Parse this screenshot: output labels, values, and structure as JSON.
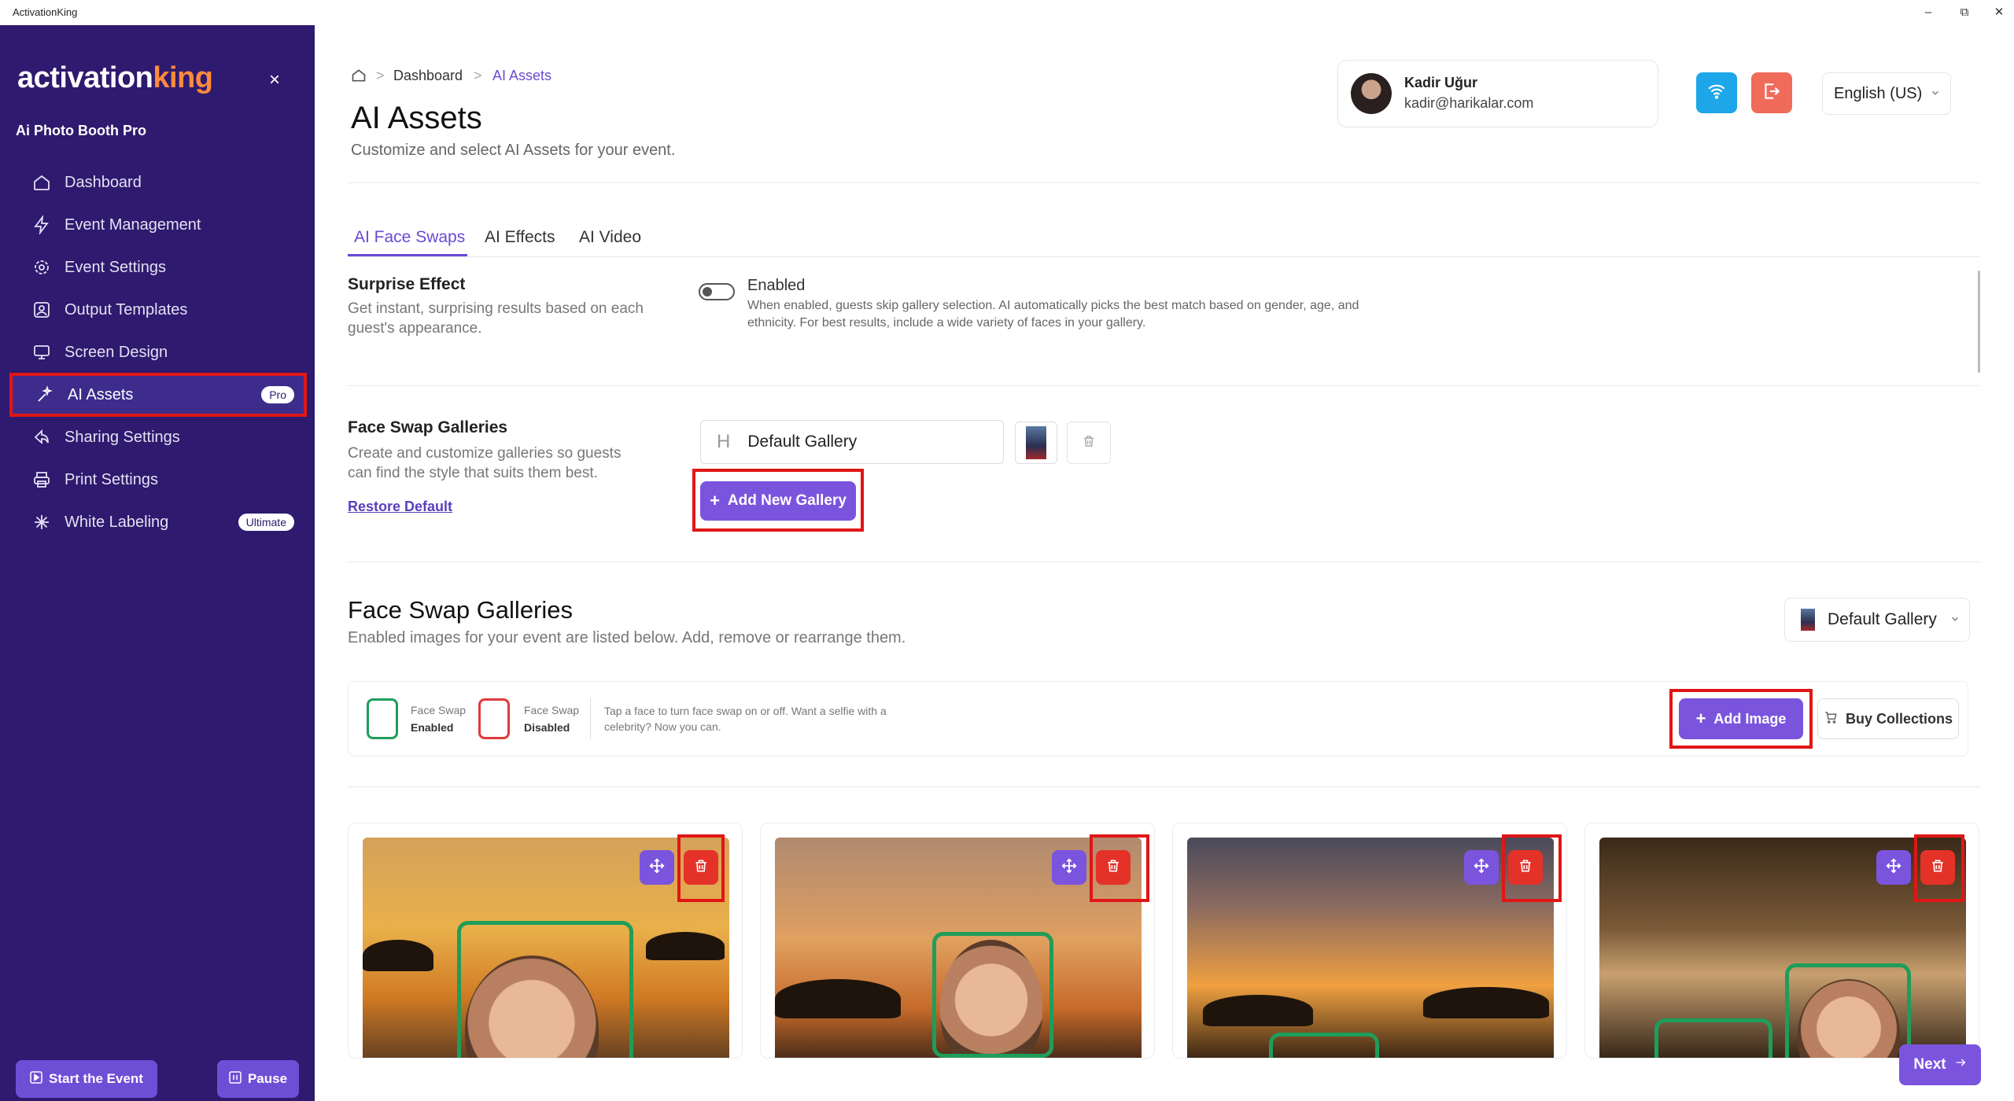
{
  "window": {
    "title": "ActivationKing",
    "minimize": "–",
    "restore": "⧉",
    "close": "✕"
  },
  "sidebar": {
    "logo_main": "activation",
    "logo_accent": "king",
    "close": "×",
    "section": "Ai Photo Booth Pro",
    "items": [
      {
        "label": "Dashboard",
        "icon": "home-icon"
      },
      {
        "label": "Event Management",
        "icon": "bolt-icon"
      },
      {
        "label": "Event Settings",
        "icon": "gear-icon"
      },
      {
        "label": "Output Templates",
        "icon": "portrait-icon"
      },
      {
        "label": "Screen Design",
        "icon": "monitor-icon"
      },
      {
        "label": "AI Assets",
        "icon": "sparkle-icon",
        "badge": "Pro",
        "active": true
      },
      {
        "label": "Sharing Settings",
        "icon": "share-icon"
      },
      {
        "label": "Print Settings",
        "icon": "printer-icon"
      },
      {
        "label": "White Labeling",
        "icon": "asterisk-icon",
        "badge": "Ultimate"
      }
    ],
    "start_button": "Start the Event",
    "pause_button": "Pause"
  },
  "breadcrumb": {
    "home_icon": "home-icon",
    "sep": ">",
    "item1": "Dashboard",
    "item2": "AI Assets"
  },
  "header": {
    "title": "AI Assets",
    "subtitle": "Customize and select AI Assets for your event.",
    "user_name": "Kadir Uğur",
    "user_email": "kadir@harikalar.com",
    "language": "English (US)"
  },
  "tabs": [
    "AI Face Swaps",
    "AI Effects",
    "AI Video"
  ],
  "surprise": {
    "title": "Surprise Effect",
    "desc": "Get instant, surprising results based on each guest's appearance.",
    "toggle_label": "Enabled",
    "toggle_enabled": false,
    "toggle_desc": "When enabled, guests skip gallery selection. AI automatically picks the best match based on gender, age, and ethnicity. For best results, include a wide variety of faces in your gallery."
  },
  "galleries_settings": {
    "title": "Face Swap Galleries",
    "desc": "Create and customize galleries so guests can find the style that suits them best.",
    "restore": "Restore Default",
    "gallery_name": "Default Gallery",
    "add_button": "Add New Gallery"
  },
  "galleries": {
    "title": "Face Swap Galleries",
    "subtitle": "Enabled images for your event are listed below. Add, remove or rearrange them.",
    "selected_gallery": "Default Gallery",
    "legend_enabled_top": "Face Swap",
    "legend_enabled_bottom": "Enabled",
    "legend_disabled_top": "Face Swap",
    "legend_disabled_bottom": "Disabled",
    "legend_desc": "Tap a face to turn face swap on or off. Want a selfie with a celebrity? Now you can.",
    "add_image": "Add Image",
    "buy_collections": "Buy Collections",
    "colors": {
      "enabled": "#1f9d5a",
      "disabled": "#e03a3a"
    }
  },
  "next_button": "Next",
  "colors": {
    "sidebar": "#2e1a6e",
    "accent": "#7b54de",
    "danger": "#e53228",
    "wifi": "#1ea7e8",
    "logout": "#f06b5a"
  }
}
